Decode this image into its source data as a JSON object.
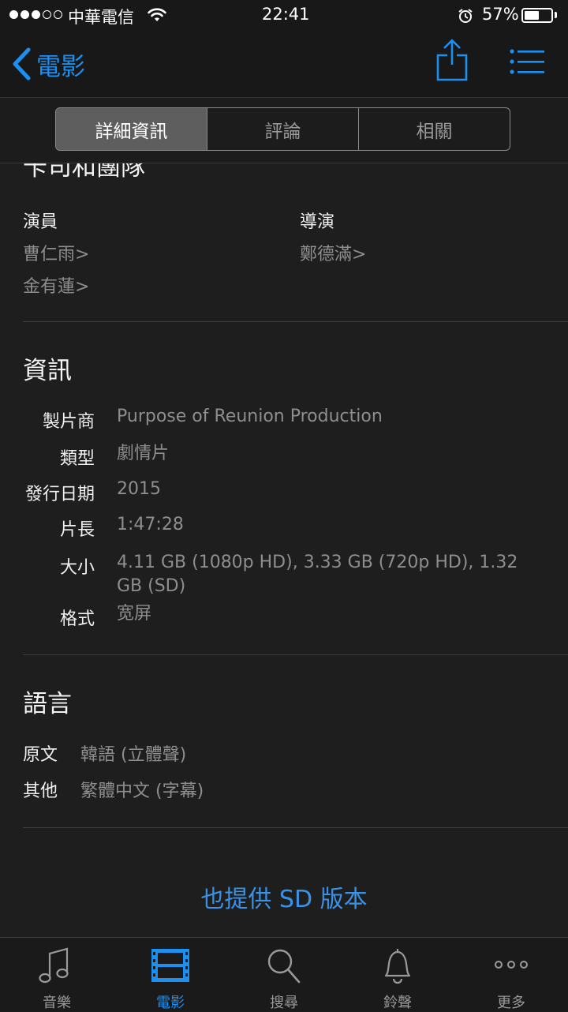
{
  "status_bar": {
    "carrier": "中華電信",
    "time": "22:41",
    "battery_percent": "57%",
    "battery_level": 0.57,
    "signal_bars": 3,
    "signal_total": 5
  },
  "nav": {
    "back_label": "電影",
    "accent": "#1d8ff0"
  },
  "tabs_segment": [
    {
      "label": "詳細資訊",
      "active": true
    },
    {
      "label": "評論",
      "active": false
    },
    {
      "label": "相關",
      "active": false
    }
  ],
  "cast": {
    "partial_heading": "卡司和團隊",
    "actors_label": "演員",
    "actors": [
      "曹仁雨",
      "金有蓮"
    ],
    "director_label": "導演",
    "directors": [
      "鄭德滿"
    ],
    "chevron": ">"
  },
  "info": {
    "heading": "資訊",
    "rows": [
      {
        "label": "製片商",
        "value": "Purpose of Reunion Production"
      },
      {
        "label": "類型",
        "value": "劇情片"
      },
      {
        "label": "發行日期",
        "value": "2015"
      },
      {
        "label": "片長",
        "value": "1:47:28"
      },
      {
        "label": "大小",
        "value": "4.11 GB (1080p HD), 3.33 GB (720p HD), 1.32 GB (SD)"
      },
      {
        "label": "格式",
        "value": "宽屏"
      }
    ]
  },
  "language": {
    "heading": "語言",
    "rows": [
      {
        "label": "原文",
        "value": "韓語 (立體聲)"
      },
      {
        "label": "其他",
        "value": "繁體中文 (字幕)"
      }
    ]
  },
  "sd_link": "也提供 SD 版本",
  "tab_bar": [
    {
      "label": "音樂",
      "icon": "music-note-icon",
      "active": false
    },
    {
      "label": "電影",
      "icon": "film-icon",
      "active": true
    },
    {
      "label": "搜尋",
      "icon": "search-icon",
      "active": false
    },
    {
      "label": "鈴聲",
      "icon": "bell-icon",
      "active": false
    },
    {
      "label": "更多",
      "icon": "more-icon",
      "active": false
    }
  ]
}
